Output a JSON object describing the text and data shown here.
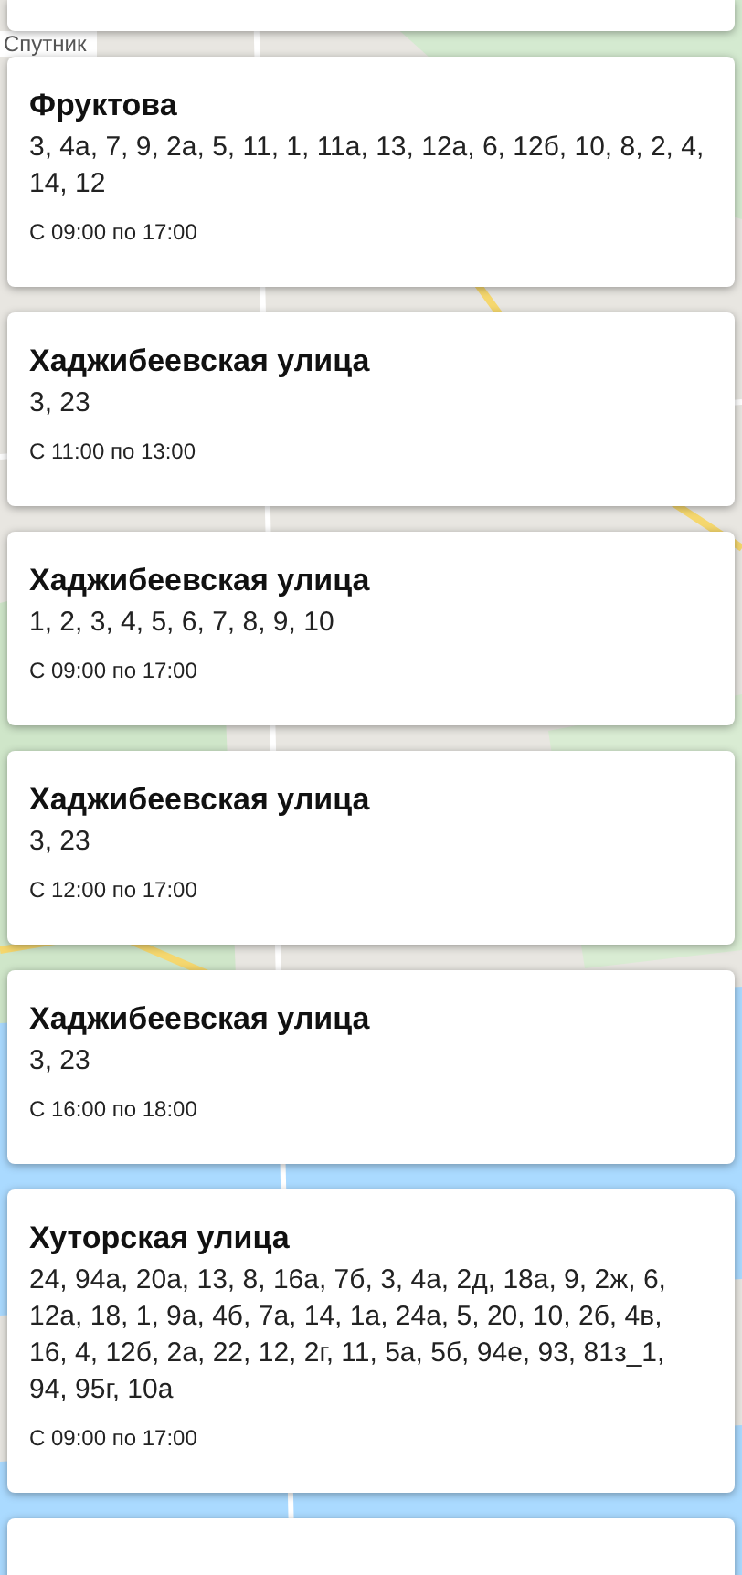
{
  "map_control": {
    "label": "Спутник"
  },
  "cards": [
    {
      "title": "Фруктова",
      "houses": "3, 4а, 7, 9, 2а, 5, 11, 1, 11а, 13, 12а, 6, 12б, 10, 8, 2, 4, 14, 12",
      "time": "С 09:00 по 17:00"
    },
    {
      "title": "Хаджибеевская улица",
      "houses": "3, 23",
      "time": "С 11:00 по 13:00"
    },
    {
      "title": "Хаджибеевская улица",
      "houses": "1, 2, 3, 4, 5, 6, 7, 8, 9, 10",
      "time": "С 09:00 по 17:00"
    },
    {
      "title": "Хаджибеевская улица",
      "houses": "3, 23",
      "time": "С 12:00 по 17:00"
    },
    {
      "title": "Хаджибеевская улица",
      "houses": "3, 23",
      "time": "С 16:00 по 18:00"
    },
    {
      "title": "Хуторская улица",
      "houses": "24, 94а, 20а, 13, 8, 16а, 7б, 3, 4а, 2д, 18а, 9, 2ж, 6, 12а, 18, 1, 9а, 4б, 7а, 14, 1а, 24а, 5, 20, 10, 2б, 4в, 16, 4, 12б, 2а, 22, 12, 2г, 11, 5а, 5б, 94е, 93, 81з_1, 94, 95г, 10а",
      "time": "С 09:00 по 17:00"
    }
  ]
}
